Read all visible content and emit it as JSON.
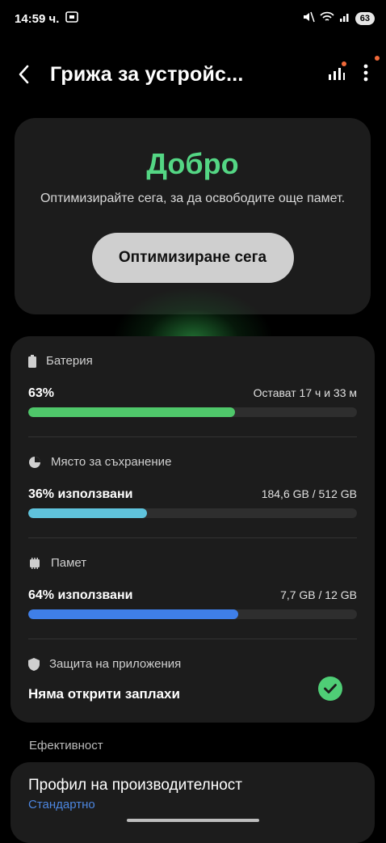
{
  "status_bar": {
    "time": "14:59 ч.",
    "battery": "63"
  },
  "header": {
    "title": "Грижа за устройс..."
  },
  "hero": {
    "status": "Добро",
    "description": "Оптимизирайте сега, за да освободите още памет.",
    "button_label": "Оптимизиране сега"
  },
  "battery": {
    "label": "Батерия",
    "value": "63%",
    "remaining": "Остават 17 ч и 33 м",
    "fraction": 0.63,
    "color": "#4fc76a"
  },
  "storage": {
    "label": "Място за съхранение",
    "value": "36% използвани",
    "detail": "184,6 GB / 512 GB",
    "fraction": 0.36,
    "color": "#5fc3dc"
  },
  "memory": {
    "label": "Памет",
    "value": "64% използвани",
    "detail": "7,7 GB / 12 GB",
    "fraction": 0.64,
    "color": "#3f7fe8"
  },
  "app_protection": {
    "label": "Защита на приложения",
    "value": "Няма открити заплахи"
  },
  "efficiency": {
    "section_label": "Ефективност",
    "profile_title": "Профил на производителност",
    "profile_value": "Стандартно"
  }
}
